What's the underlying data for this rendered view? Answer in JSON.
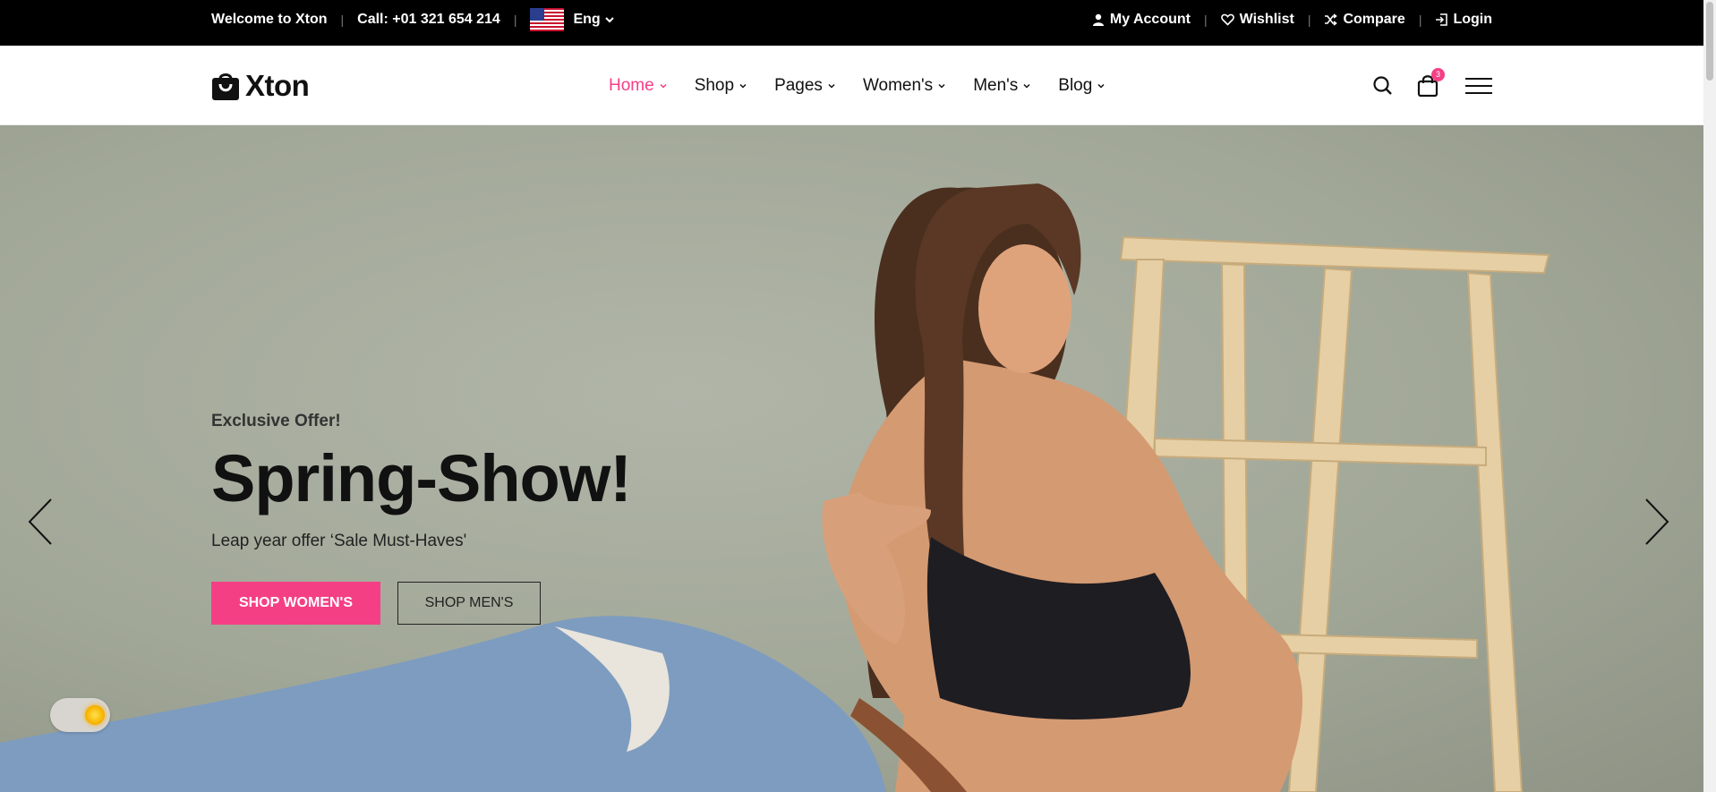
{
  "topbar": {
    "welcome": "Welcome to Xton",
    "call": "Call: +01 321 654 214",
    "language": "Eng",
    "links": [
      {
        "label": "My Account",
        "icon": "user-icon"
      },
      {
        "label": "Wishlist",
        "icon": "heart-icon"
      },
      {
        "label": "Compare",
        "icon": "shuffle-icon"
      },
      {
        "label": "Login",
        "icon": "login-icon"
      }
    ]
  },
  "header": {
    "brand": "Xton",
    "nav": [
      {
        "label": "Home",
        "active": true
      },
      {
        "label": "Shop"
      },
      {
        "label": "Pages"
      },
      {
        "label": "Women's"
      },
      {
        "label": "Men's"
      },
      {
        "label": "Blog"
      }
    ],
    "cart_count": "3"
  },
  "hero": {
    "kicker": "Exclusive Offer!",
    "headline": "Spring-Show!",
    "subtitle": "Leap year offer ‘Sale Must-Haves'",
    "primary_button": "SHOP WOMEN'S",
    "secondary_button": "SHOP MEN'S"
  },
  "colors": {
    "accent": "#f53f85",
    "topbar_bg": "#000000",
    "hero_bg": "#a7ac9e"
  }
}
